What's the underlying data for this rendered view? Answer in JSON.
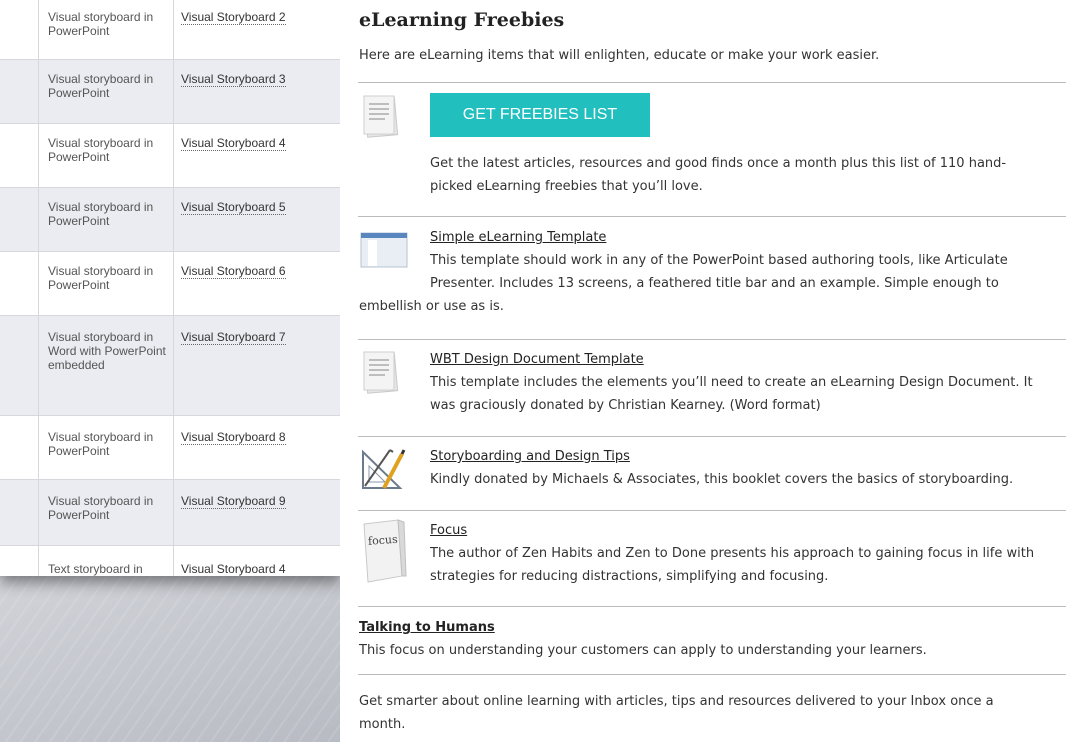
{
  "table": {
    "rows": [
      {
        "description": "Visual storyboard in PowerPoint",
        "link": "Visual Storyboard 2"
      },
      {
        "description": "Visual storyboard in PowerPoint",
        "link": "Visual Storyboard 3"
      },
      {
        "description": "Visual storyboard in PowerPoint",
        "link": "Visual Storyboard 4"
      },
      {
        "description": "Visual storyboard in PowerPoint",
        "link": "Visual Storyboard 5"
      },
      {
        "description": "Visual storyboard in PowerPoint",
        "link": "Visual Storyboard 6"
      },
      {
        "description": "Visual storyboard in Word with PowerPoint embedded",
        "link": "Visual Storyboard 7"
      },
      {
        "description": "Visual storyboard in PowerPoint",
        "link": "Visual Storyboard 8"
      },
      {
        "description": "Visual storyboard in PowerPoint",
        "link": "Visual Storyboard 9"
      },
      {
        "description": "Text storyboard in",
        "link": "Visual Storyboard 4"
      }
    ]
  },
  "freebies": {
    "title": "eLearning Freebies",
    "intro": "Here are eLearning items that will enlighten, educate or make your work easier.",
    "cta_label": "GET FREEBIES LIST",
    "cta_text_line1": "Get the latest articles, resources and good finds once a month plus this list of 110 hand-",
    "cta_text_line2": "picked eLearning freebies that you’ll love.",
    "items": [
      {
        "title": "Simple eLearning Template",
        "line1": "This template should work in any of the PowerPoint based authoring tools, like Articulate",
        "line2": "Presenter. Includes 13 screens, a feathered title bar and an example. Simple enough to",
        "line3": "embellish or use as is."
      },
      {
        "title": "WBT Design Document Template",
        "line1": "This template includes the elements you’ll need to create an eLearning Design Document. It",
        "line2": "was graciously donated by Christian Kearney. (Word format)"
      },
      {
        "title": "Storyboarding and Design Tips",
        "line1": "Kindly donated by Michaels & Associates, this booklet covers the basics of storyboarding."
      },
      {
        "title": "Focus",
        "line1": "The author of Zen Habits and Zen to Done presents his approach to gaining focus in life with",
        "line2": "strategies for reducing distractions, simplifying and focusing.",
        "book_label": "focus"
      }
    ],
    "talking": {
      "title": "Talking to Humans",
      "text": "This focus on understanding your customers can apply to understanding your learners."
    },
    "footer_line1": "Get smarter about online learning with articles, tips and resources delivered to your Inbox once a",
    "footer_line2": "month."
  },
  "colors": {
    "accent": "#22bfbf"
  }
}
